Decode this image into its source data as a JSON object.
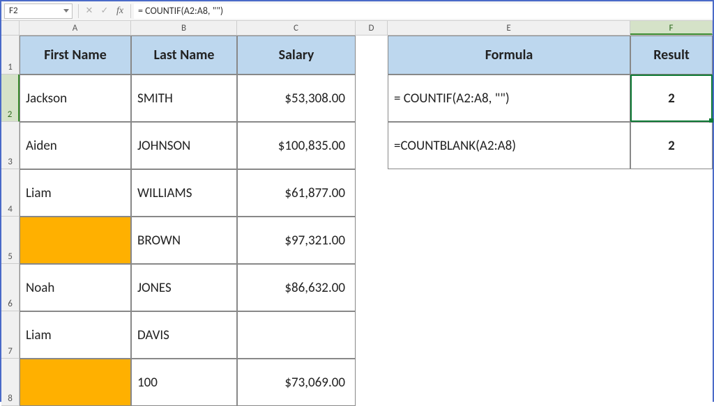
{
  "name_box": {
    "value": "F2"
  },
  "formula_bar": {
    "cancel": "✕",
    "enter": "✓",
    "fx": "fx",
    "value": "= COUNTIF(A2:A8, \"\")"
  },
  "columns": [
    "A",
    "B",
    "C",
    "D",
    "E",
    "F"
  ],
  "row_numbers": [
    "1",
    "2",
    "3",
    "4",
    "5",
    "6",
    "7",
    "8"
  ],
  "headers": {
    "first_name": "First Name",
    "last_name": "Last Name",
    "salary": "Salary",
    "formula": "Formula",
    "result": "Result"
  },
  "rows": [
    {
      "first": "Jackson",
      "last": "SMITH",
      "salary": "$53,308.00"
    },
    {
      "first": "Aiden",
      "last": "JOHNSON",
      "salary": "$100,835.00"
    },
    {
      "first": "Liam",
      "last": "WILLIAMS",
      "salary": "$61,877.00"
    },
    {
      "first": "",
      "last": "BROWN",
      "salary": "$97,321.00",
      "blank": true
    },
    {
      "first": "Noah",
      "last": "JONES",
      "salary": "$86,632.00"
    },
    {
      "first": "Liam",
      "last": "DAVIS",
      "salary": ""
    },
    {
      "first": "",
      "last": "100",
      "salary": "$73,069.00",
      "blank": true
    }
  ],
  "formula_rows": [
    {
      "formula": "= COUNTIF(A2:A8, \"\")",
      "result": "2"
    },
    {
      "formula": "=COUNTBLANK(A2:A8)",
      "result": "2"
    }
  ],
  "selected": {
    "col": "F",
    "row": "2"
  }
}
